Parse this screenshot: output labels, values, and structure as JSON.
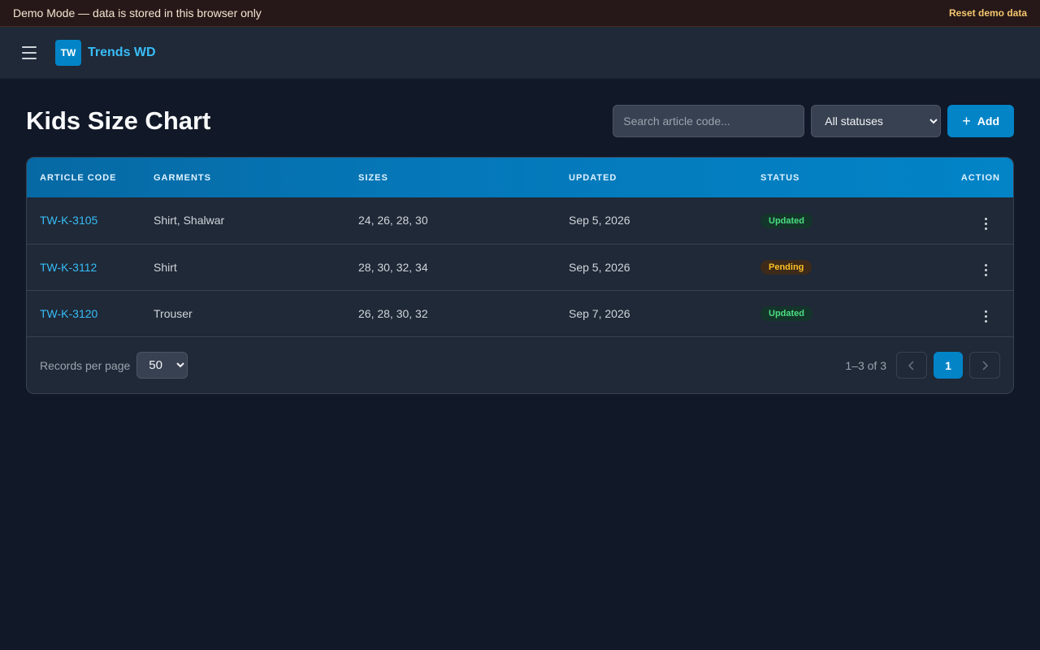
{
  "demo_banner": {
    "message": "Demo Mode — data is stored in this browser only",
    "reset_label": "Reset demo data"
  },
  "nav": {
    "menu_icon": "hamburger-icon",
    "logo_text": "TW",
    "brand": "Trends WD"
  },
  "page": {
    "title": "Kids Size Chart",
    "search_placeholder": "Search article code...",
    "status_filter": {
      "selected": "All statuses",
      "options": [
        "All statuses"
      ]
    },
    "add_label": "Add",
    "add_icon": "plus-icon"
  },
  "table": {
    "columns": [
      "ARTICLE CODE",
      "GARMENTS",
      "SIZES",
      "UPDATED",
      "STATUS",
      "ACTION"
    ],
    "rows": [
      {
        "code": "TW-K-3105",
        "garments": "Shirt, Shalwar",
        "sizes": "24, 26, 28, 30",
        "updated": "Sep 5, 2026",
        "status": "Updated"
      },
      {
        "code": "TW-K-3112",
        "garments": "Shirt",
        "sizes": "28, 30, 32, 34",
        "updated": "Sep 5, 2026",
        "status": "Pending"
      },
      {
        "code": "TW-K-3120",
        "garments": "Trouser",
        "sizes": "26, 28, 30, 32",
        "updated": "Sep 7, 2026",
        "status": "Updated"
      }
    ]
  },
  "footer": {
    "records_label": "Records per page",
    "records_per_page": "50",
    "records_options": [
      "50"
    ],
    "range": "1–3 of 3",
    "current_page": "1"
  },
  "colors": {
    "accent": "#0284c7",
    "link": "#38bdf8",
    "updated": "#4ade80",
    "pending": "#fbbf24"
  }
}
